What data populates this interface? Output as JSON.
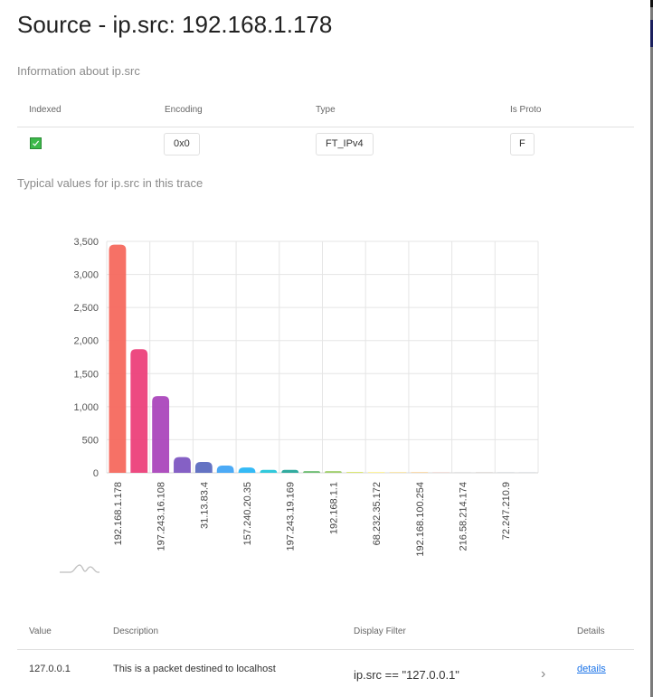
{
  "dialog": {
    "title": "Source - ip.src: 192.168.1.178",
    "info_heading": "Information about ip.src",
    "typical_heading": "Typical values for ip.src in this trace"
  },
  "info_table": {
    "columns": [
      "Indexed",
      "Encoding",
      "Type",
      "Is Proto"
    ],
    "row": {
      "indexed": true,
      "encoding": "0x0",
      "type": "FT_IPv4",
      "is_proto": "F"
    }
  },
  "chart_data": {
    "type": "bar",
    "title": "",
    "xlabel": "",
    "ylabel": "",
    "ylim": [
      0,
      3500
    ],
    "yticks": [
      0,
      500,
      1000,
      1500,
      2000,
      2500,
      3000,
      3500
    ],
    "ytick_labels": [
      "0",
      "500",
      "1,000",
      "1,500",
      "2,000",
      "2,500",
      "3,000",
      "3,500"
    ],
    "grid": true,
    "legend": "none",
    "categories": [
      "192.168.1.178",
      "",
      "197.243.16.108",
      "",
      "31.13.83.4",
      "",
      "157.240.20.35",
      "",
      "197.243.19.169",
      "",
      "192.168.1.1",
      "",
      "68.232.35.172",
      "",
      "192.168.100.254",
      "",
      "216.58.214.174",
      "",
      "72.247.210.9",
      ""
    ],
    "values": [
      3450,
      1870,
      1160,
      237,
      164,
      110,
      80,
      45,
      45,
      25,
      25,
      12,
      8,
      5,
      5,
      2,
      4,
      1,
      1,
      1
    ],
    "colors": [
      "#f6695e",
      "#ec407a",
      "#ab47bc",
      "#7e57c2",
      "#5c6bc0",
      "#42a5f5",
      "#29b6f6",
      "#26c6da",
      "#26a69a",
      "#66bb6a",
      "#9ccc65",
      "#d4e157",
      "#ffee58",
      "#ffca28",
      "#ffa726",
      "#ff7043",
      "#bdbdbd",
      "#8d6e63",
      "#78909c",
      "#90a4ae"
    ]
  },
  "values_table": {
    "columns": [
      "Value",
      "Description",
      "Display Filter",
      "Details"
    ],
    "rows": [
      {
        "value": "127.0.0.1",
        "description": "This is a packet destined to localhost",
        "filter": "ip.src == \"127.0.0.1\"",
        "details": "details"
      }
    ]
  },
  "icons": {
    "check": "check-icon",
    "chevron": "chevron-right-icon",
    "sparkline": "distribution-sparkline-icon"
  }
}
